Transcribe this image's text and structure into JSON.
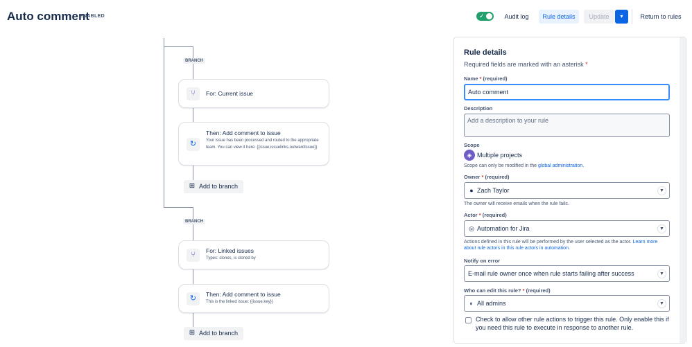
{
  "header": {
    "title": "Auto comment",
    "status_label": "ENABLED",
    "toggle_check": "✓",
    "audit_log": "Audit log",
    "rule_details": "Rule details",
    "update": "Update",
    "update_caret": "▾",
    "return": "Return to rules"
  },
  "flow": {
    "branch1_tag": "BRANCH",
    "branch1_for": "For: Current issue",
    "branch1_then_title": "Then: Add comment to issue",
    "branch1_then_body": "Your issue has been processed and routed to the appropriate team. You can view it here: {{issue.issuelinks.outwardIssue}}",
    "add_branch_1": "Add to branch",
    "branch2_tag": "BRANCH",
    "branch2_for": "For: Linked issues",
    "branch2_for_sub": "Types: clones, is cloned by",
    "branch2_then_title": "Then: Add comment to issue",
    "branch2_then_body": "This is the linked issue: {{issue.key}}",
    "add_branch_2": "Add to branch"
  },
  "panel": {
    "title": "Rule details",
    "required_note": "Required fields are marked with an asterisk",
    "asterisk": "*",
    "name_label": "Name",
    "name_req": "(required)",
    "name_value": "Auto comment",
    "description_label": "Description",
    "description_placeholder": "Add a description to your rule",
    "scope_label": "Scope",
    "scope_value": "Multiple projects",
    "scope_helper_pre": "Scope can only be modified in the",
    "scope_helper_link": "global administration",
    "scope_helper_post": ".",
    "owner_label": "Owner",
    "owner_req": "(required)",
    "owner_value": "Zach Taylor",
    "owner_helper": "The owner will receive emails when the rule fails.",
    "actor_label": "Actor",
    "actor_req": "(required)",
    "actor_value": "Automation for Jira",
    "actor_helper_pre": "Actions defined in this rule will be performed by the user selected as the actor.",
    "actor_helper_link": "Learn more about rule actors in this rule actors in automation.",
    "notify_label": "Notify on error",
    "notify_value": "E-mail rule owner once when rule starts failing after success",
    "who_label": "Who can edit this rule?",
    "who_req": "(required)",
    "who_value": "All admins",
    "check_text": "Check to allow other rule actions to trigger this rule. Only enable this if you need this rule to execute in response to another rule."
  },
  "icons": {
    "branch_icon": "branch-icon",
    "action_icon": "refresh-icon",
    "plus_icon": "plus-icon",
    "scope_icon": "projects-icon",
    "owner_icon": "user-avatar-icon",
    "actor_icon": "automation-icon",
    "caret_icon": "chevron-down-icon"
  },
  "colors": {
    "accent": "#0c66e4",
    "success": "#22a06b",
    "required": "#c9372c",
    "scope_purple": "#6e5dc6"
  }
}
